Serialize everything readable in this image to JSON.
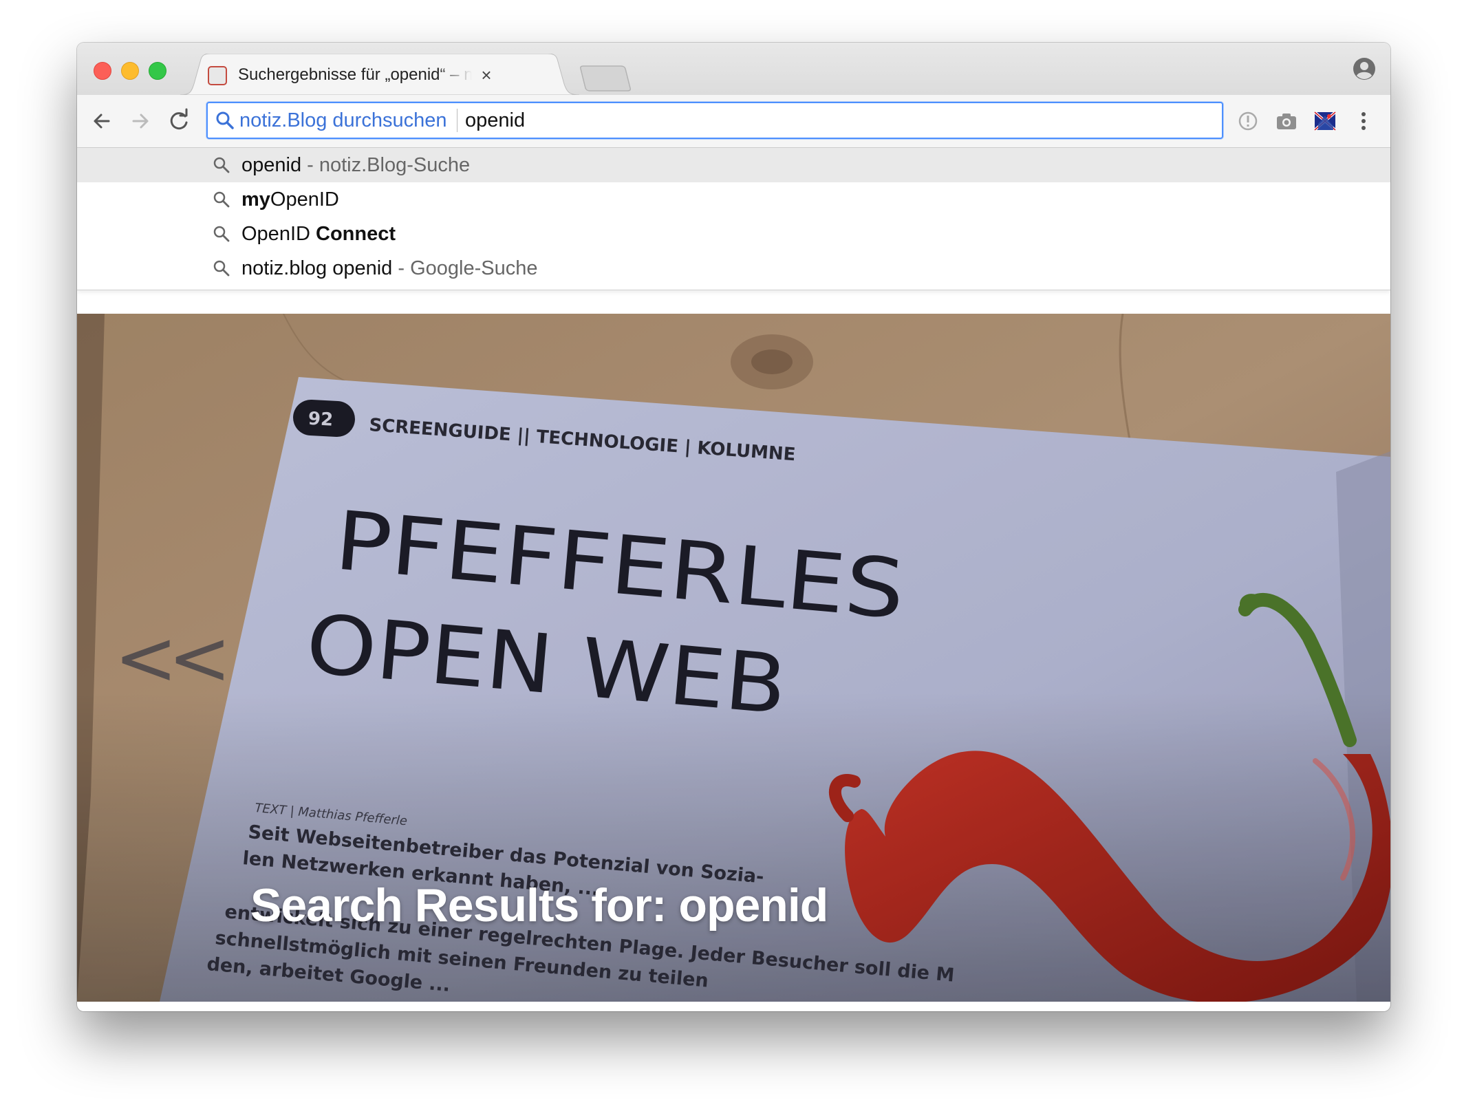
{
  "browser": {
    "tab": {
      "title": "Suchergebnisse für „openid“ – notiz.Blog",
      "close_glyph": "×"
    },
    "omnibox": {
      "keyword_label": "notiz.Blog durchsuchen",
      "value": "openid"
    }
  },
  "suggestions": [
    {
      "main": "openid",
      "bold": "",
      "rest": "",
      "sub": " - notiz.Blog-Suche",
      "selected": true
    },
    {
      "main": "",
      "bold": "my",
      "rest": "OpenID",
      "sub": "",
      "selected": false
    },
    {
      "main": "OpenID ",
      "bold": "Connect",
      "rest": "",
      "sub": "",
      "selected": false
    },
    {
      "main": "notiz.blog openid",
      "bold": "",
      "rest": "",
      "sub": " - Google-Suche",
      "selected": false
    }
  ],
  "page": {
    "prev_arrow": "<<",
    "heading": "Search Results for: openid",
    "image": {
      "page_number": "92",
      "section": "SCREENGUIDE || TECHNOLOGIE | KOLUMNE",
      "title_line1": "PFEFFERLES",
      "title_line2": "OPEN WEB",
      "byline": "TEXT | Matthias Pfefferle",
      "body_lines": [
        "Seit Webseitenbetreiber das Potenzial von Sozia-",
        "len Netzwerken erkannt haben, ...",
        "entwickelt sich zu einer regelrechten Plage. Jeder Besucher soll die M",
        "schnellstmöglich mit seinen Freunden zu teilen",
        "den, arbeitet Google ..."
      ]
    }
  },
  "icons": {
    "back": "arrow-left-icon",
    "forward": "arrow-right-icon",
    "reload": "reload-icon",
    "search": "magnifier-icon",
    "info": "info-circle-icon",
    "camera": "camera-icon",
    "extension": "flag-extension-icon",
    "menu": "kebab-menu-icon",
    "profile": "person-circle-icon"
  },
  "colors": {
    "accent": "#4d90fe",
    "keyword": "#3b72d8",
    "heading": "#ffffff",
    "pepper": "#b5271c"
  }
}
